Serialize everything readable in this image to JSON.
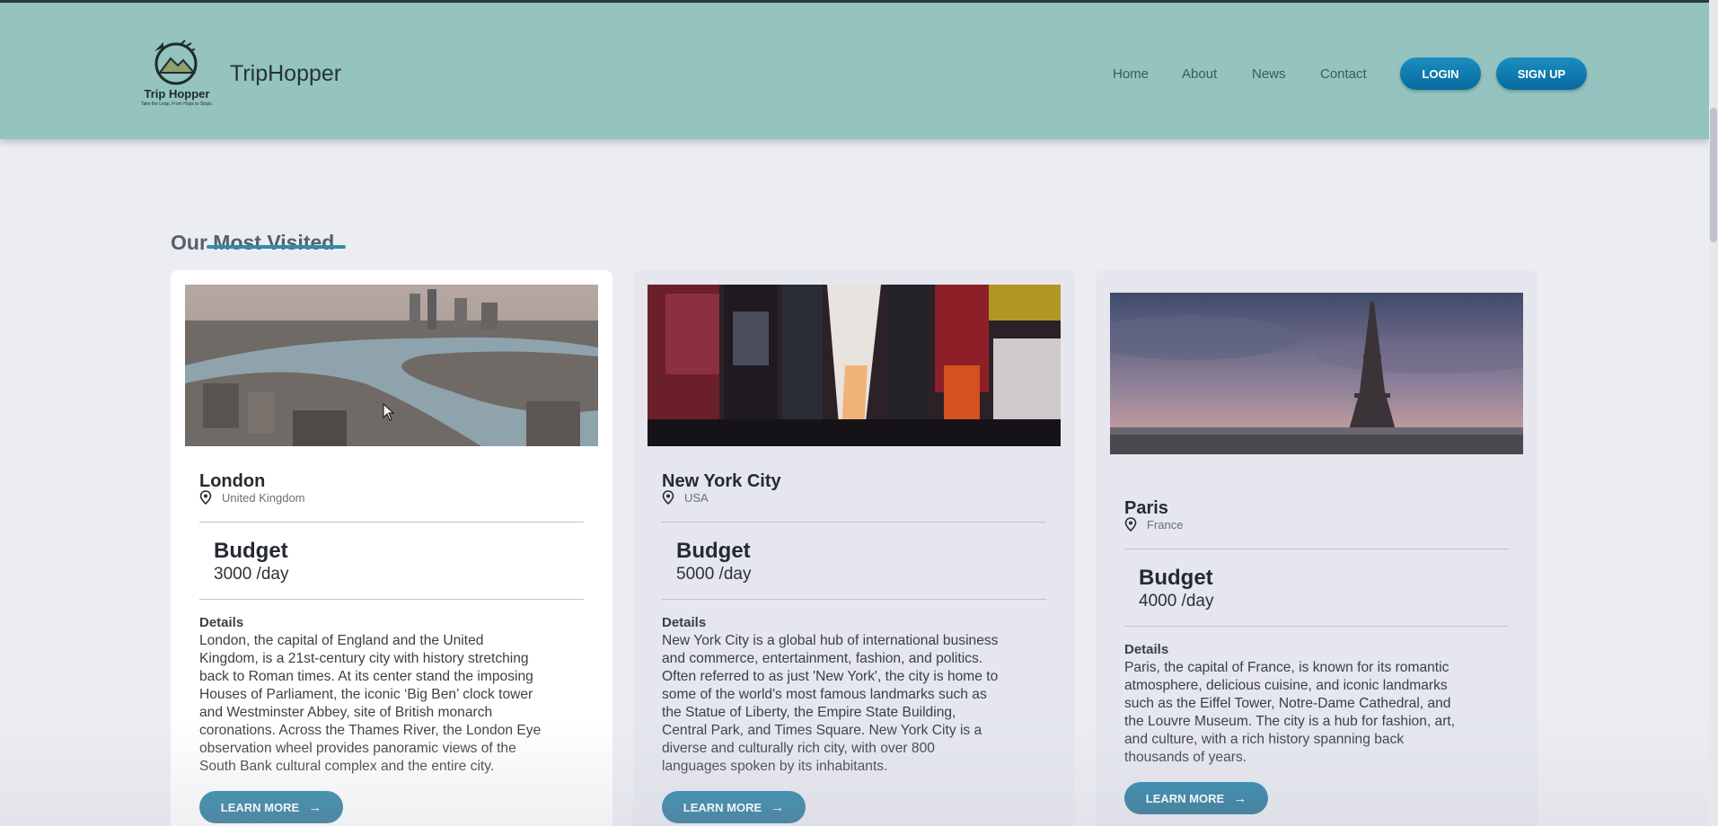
{
  "brand": {
    "logo_text": "Trip Hopper",
    "logo_tagline": "Take the Leap, From Hops to Stops.",
    "name": "TripHopper"
  },
  "nav": {
    "links": [
      "Home",
      "About",
      "News",
      "Contact"
    ],
    "login_label": "LOGIN",
    "signup_label": "SIGN UP"
  },
  "section": {
    "title": "Our Most Visited"
  },
  "cards": [
    {
      "city": "London",
      "country": "United Kingdom",
      "budget_label": "Budget",
      "budget_value": "3000 /day",
      "details_label": "Details",
      "details_lines": [
        "London, the capital of England and the United",
        "Kingdom, is a 21st-century city with history stretching",
        "back to Roman times. At its center stand the imposing",
        "Houses of Parliament, the iconic ‘Big Ben’ clock tower",
        "and Westminster Abbey, site of British monarch",
        "coronations. Across the Thames River, the London Eye",
        "observation wheel provides panoramic views of the",
        "South Bank cultural complex and the entire city."
      ],
      "button_label": "LEARN MORE"
    },
    {
      "city": "New York City",
      "country": "USA",
      "budget_label": "Budget",
      "budget_value": "5000 /day",
      "details_label": "Details",
      "details_lines": [
        "New York City is a global hub of international business",
        "and commerce, entertainment, fashion, and politics.",
        "Often referred to as just 'New York', the city is home to",
        "some of the world's most famous landmarks such as",
        "the Statue of Liberty, the Empire State Building,",
        "Central Park, and Times Square. New York City is a",
        "diverse and culturally rich city, with over 800",
        "languages spoken by its inhabitants."
      ],
      "button_label": "LEARN MORE"
    },
    {
      "city": "Paris",
      "country": "France",
      "budget_label": "Budget",
      "budget_value": "4000 /day",
      "details_label": "Details",
      "details_lines": [
        "Paris, the capital of France, is known for its romantic",
        "atmosphere, delicious cuisine, and iconic landmarks",
        "such as the Eiffel Tower, Notre-Dame Cathedral, and",
        "the Louvre Museum. The city is a hub for fashion, art,",
        "and culture, with a rich history spanning back",
        "thousands of years."
      ],
      "button_label": "LEARN MORE"
    }
  ],
  "colors": {
    "navbar": "#94c3c0",
    "button_blue": "#0a7db5",
    "learn_more": "#14729a",
    "accent_underline": "#2e8fa4"
  },
  "icons": [
    "location-pin-icon",
    "arrow-right-icon",
    "mouse-cursor-icon"
  ]
}
